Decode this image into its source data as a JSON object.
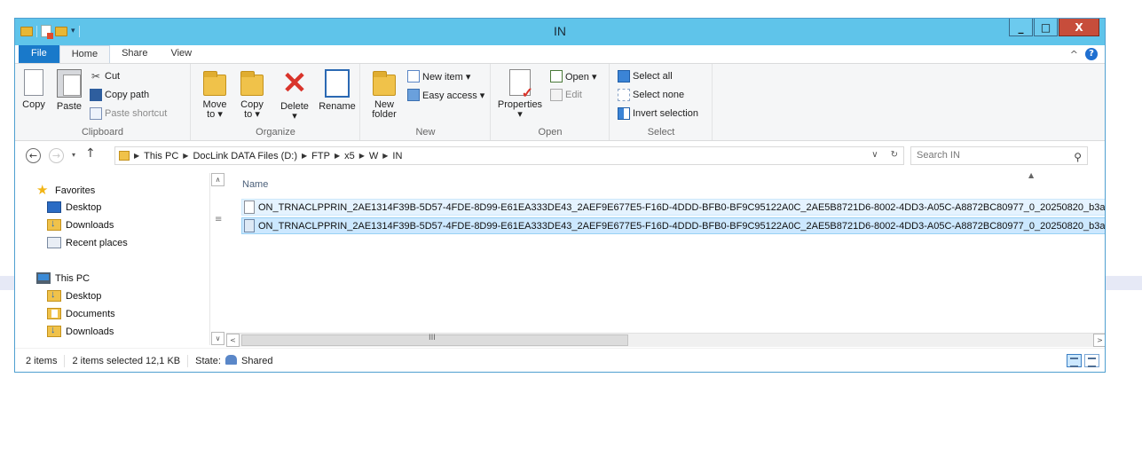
{
  "window": {
    "title": "IN"
  },
  "title_buttons": {
    "minimize": "_",
    "maximize": "□",
    "close": "X"
  },
  "ribbon_tabs": [
    {
      "label": "File"
    },
    {
      "label": "Home"
    },
    {
      "label": "Share"
    },
    {
      "label": "View"
    }
  ],
  "ribbon": {
    "clipboard": {
      "label": "Clipboard",
      "copy": "Copy",
      "paste": "Paste",
      "cut": "Cut",
      "copy_path": "Copy path",
      "paste_shortcut": "Paste shortcut"
    },
    "organize": {
      "label": "Organize",
      "move_to": "Move to ▾",
      "copy_to": "Copy to ▾",
      "delete": "Delete ▾",
      "rename": "Rename"
    },
    "new": {
      "label": "New",
      "new_folder": "New folder",
      "new_item": "New item ▾",
      "easy_access": "Easy access ▾"
    },
    "open": {
      "label": "Open",
      "properties": "Properties ▾",
      "open": "Open ▾",
      "edit": "Edit"
    },
    "select": {
      "label": "Select",
      "select_all": "Select all",
      "select_none": "Select none",
      "invert_selection": "Invert selection"
    }
  },
  "address": {
    "breadcrumbs": [
      "This PC",
      "DocLink DATA Files (D:)",
      "FTP",
      "x5",
      "W",
      "IN"
    ]
  },
  "search": {
    "placeholder": "Search IN"
  },
  "nav_pane": {
    "favorites": {
      "label": "Favorites",
      "items": [
        "Desktop",
        "Downloads",
        "Recent places"
      ]
    },
    "this_pc": {
      "label": "This PC",
      "items": [
        "Desktop",
        "Documents",
        "Downloads"
      ]
    }
  },
  "file_list": {
    "column_name": "Name",
    "rows": [
      {
        "name": "ON_TRNACLPPRIN_2AE1314F39B-5D57-4FDE-8D99-E61EA333DE43_2AEF9E677E5-F16D-4DDD-BFB0-BF9C95122A0C_2AE5B8721D6-8002-4DD3-A05C-A8872BC80977_0_20250820_b3a"
      },
      {
        "name": "ON_TRNACLPPRIN_2AE1314F39B-5D57-4FDE-8D99-E61EA333DE43_2AEF9E677E5-F16D-4DDD-BFB0-BF9C95122A0C_2AE5B8721D6-8002-4DD3-A05C-A8872BC80977_0_20250820_b3a"
      }
    ]
  },
  "status_bar": {
    "item_count": "2 items",
    "selection": "2 items selected  12,1 KB",
    "state_label": "State:",
    "state_value": "Shared"
  }
}
